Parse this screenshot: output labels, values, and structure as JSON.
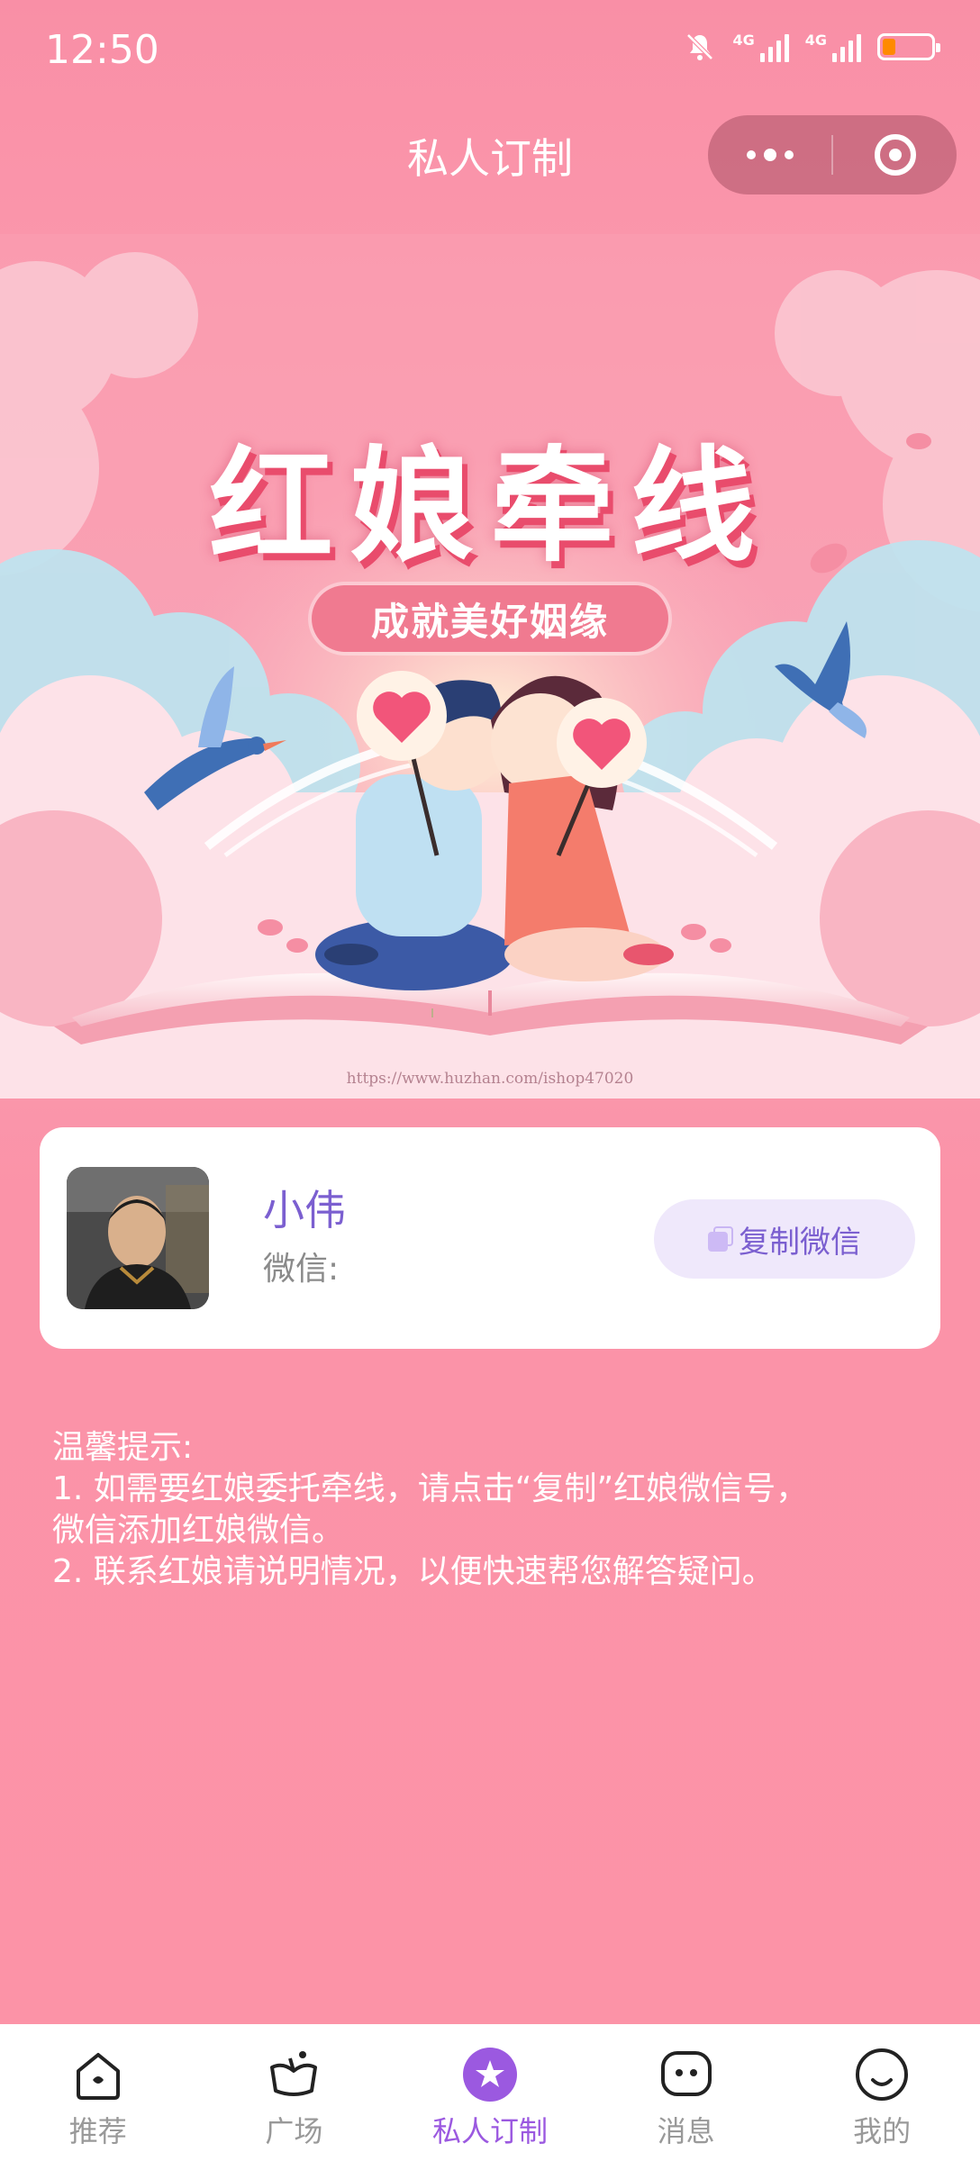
{
  "status_bar": {
    "time": "12:50",
    "network_1": "4G",
    "network_2": "4G"
  },
  "nav": {
    "title": "私人订制"
  },
  "banner": {
    "title": "红娘牵线",
    "subtitle": "成就美好姻缘",
    "watermark": "https://www.huzhan.com/ishop47020"
  },
  "contact": {
    "name": "小伟",
    "wechat_label": "微信:",
    "copy_button": "复制微信"
  },
  "tips": {
    "heading": "温馨提示:",
    "lines": [
      "1. 如需要红娘委托牵线，请点击“复制”红娘微信号，",
      "微信添加红娘微信。",
      "2. 联系红娘请说明情况，以便快速帮您解答疑问。"
    ]
  },
  "tabbar": {
    "active_index": 2,
    "items": [
      {
        "label": "推荐",
        "icon": "home-icon"
      },
      {
        "label": "广场",
        "icon": "plaza-icon"
      },
      {
        "label": "私人订制",
        "icon": "star-badge-icon"
      },
      {
        "label": "消息",
        "icon": "chat-icon"
      },
      {
        "label": "我的",
        "icon": "smile-icon"
      }
    ]
  },
  "colors": {
    "accent": "#9b59e0",
    "card_name": "#7b5fd0",
    "page_pink": "#fb93a8",
    "tab_inactive": "#999999"
  }
}
